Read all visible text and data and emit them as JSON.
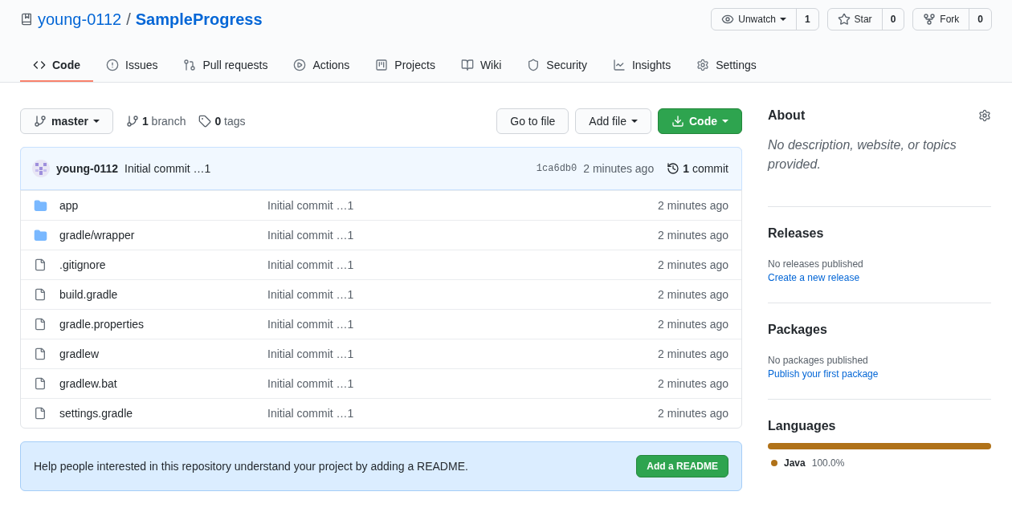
{
  "repo": {
    "owner": "young-0112",
    "separator": "/",
    "name": "SampleProgress"
  },
  "header_buttons": [
    {
      "label": "Unwatch",
      "dropdown": true,
      "count": "1"
    },
    {
      "label": "Star",
      "dropdown": false,
      "count": "0"
    },
    {
      "label": "Fork",
      "dropdown": false,
      "count": "0"
    }
  ],
  "tabs": [
    {
      "label": "Code",
      "selected": true
    },
    {
      "label": "Issues",
      "selected": false
    },
    {
      "label": "Pull requests",
      "selected": false
    },
    {
      "label": "Actions",
      "selected": false
    },
    {
      "label": "Projects",
      "selected": false
    },
    {
      "label": "Wiki",
      "selected": false
    },
    {
      "label": "Security",
      "selected": false
    },
    {
      "label": "Insights",
      "selected": false
    },
    {
      "label": "Settings",
      "selected": false
    }
  ],
  "branch_select": "master",
  "branch_count": "**1** branch",
  "tag_count": "**0** tags",
  "actions": {
    "go_to_file": "Go to file",
    "add_file": "Add file",
    "code": "Code"
  },
  "latest_commit": {
    "author": "young-0112",
    "message": "Initial commit …1",
    "sha": "1ca6db0",
    "time": "2 minutes ago",
    "commits": "**1** commit"
  },
  "files": [
    {
      "kind": "dir",
      "name": "app",
      "message": "Initial commit …1",
      "time": "2 minutes ago"
    },
    {
      "kind": "dir",
      "name": "gradle/wrapper",
      "message": "Initial commit …1",
      "time": "2 minutes ago"
    },
    {
      "kind": "file",
      "name": ".gitignore",
      "message": "Initial commit …1",
      "time": "2 minutes ago"
    },
    {
      "kind": "file",
      "name": "build.gradle",
      "message": "Initial commit …1",
      "time": "2 minutes ago"
    },
    {
      "kind": "file",
      "name": "gradle.properties",
      "message": "Initial commit …1",
      "time": "2 minutes ago"
    },
    {
      "kind": "file",
      "name": "gradlew",
      "message": "Initial commit …1",
      "time": "2 minutes ago"
    },
    {
      "kind": "file",
      "name": "gradlew.bat",
      "message": "Initial commit …1",
      "time": "2 minutes ago"
    },
    {
      "kind": "file",
      "name": "settings.gradle",
      "message": "Initial commit …1",
      "time": "2 minutes ago"
    }
  ],
  "readme_banner": {
    "text": "Help people interested in this repository understand your project by adding a README.",
    "button": "Add a README"
  },
  "sidebar": {
    "about": {
      "title": "About",
      "text": "No description, website, or topics provided."
    },
    "releases": {
      "title": "Releases",
      "text": "No releases published",
      "link": "Create a new release"
    },
    "packages": {
      "title": "Packages",
      "text": "No packages published",
      "link": "Publish your first package"
    },
    "languages": {
      "title": "Languages",
      "items": [
        {
          "name": "Java",
          "percent": "100.0%",
          "level": 1.0,
          "color": "#b07219"
        }
      ]
    }
  }
}
